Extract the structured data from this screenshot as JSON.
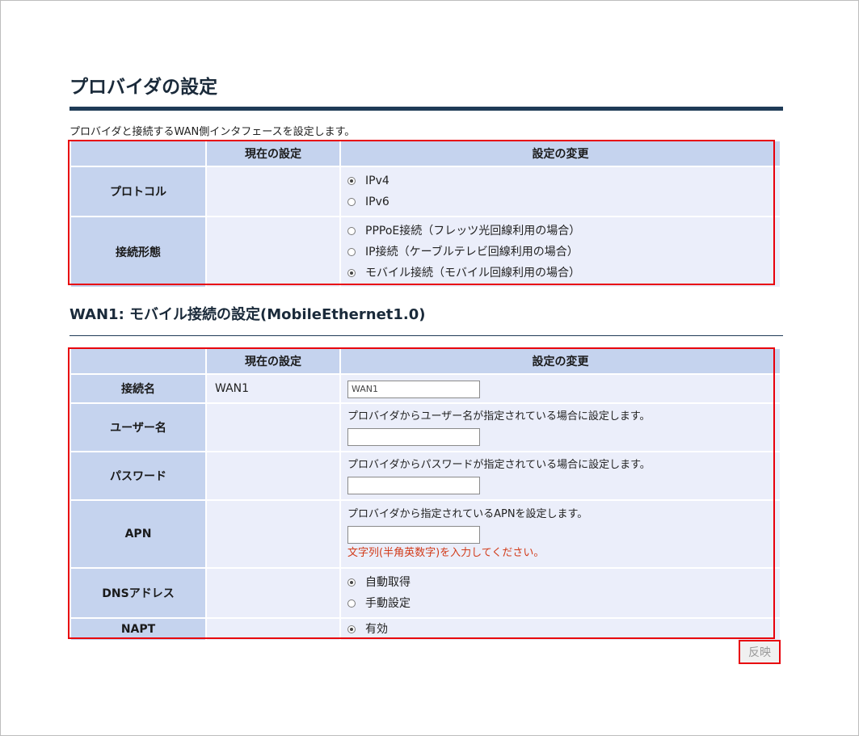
{
  "header": {
    "title": "プロバイダの設定",
    "description": "プロバイダと接続するWAN側インタフェースを設定します。"
  },
  "table_headers": {
    "current": "現在の設定",
    "change": "設定の変更"
  },
  "section1": {
    "rows": {
      "protocol": {
        "label": "プロトコル",
        "current": "",
        "options": [
          "IPv4",
          "IPv6"
        ],
        "selected": "IPv4"
      },
      "connection_type": {
        "label": "接続形態",
        "current": "",
        "options": [
          "PPPoE接続（フレッツ光回線利用の場合）",
          "IP接続（ケーブルテレビ回線利用の場合）",
          "モバイル接続（モバイル回線利用の場合）"
        ],
        "selected": "モバイル接続（モバイル回線利用の場合）"
      }
    }
  },
  "section2": {
    "title": "WAN1: モバイル接続の設定(MobileEthernet1.0)",
    "rows": {
      "connection_name": {
        "label": "接続名",
        "current": "WAN1",
        "input_value": "WAN1"
      },
      "username": {
        "label": "ユーザー名",
        "current": "",
        "hint": "プロバイダからユーザー名が指定されている場合に設定します。",
        "input_value": ""
      },
      "password": {
        "label": "パスワード",
        "current": "",
        "hint": "プロバイダからパスワードが指定されている場合に設定します。",
        "input_value": ""
      },
      "apn": {
        "label": "APN",
        "current": "",
        "hint": "プロバイダから指定されているAPNを設定します。",
        "input_value": "",
        "warning": "文字列(半角英数字)を入力してください。"
      },
      "dns": {
        "label": "DNSアドレス",
        "current": "",
        "options": [
          "自動取得",
          "手動設定"
        ],
        "selected": "自動取得"
      },
      "napt": {
        "label": "NAPT",
        "current": "",
        "options": [
          "有効"
        ],
        "selected": "有効"
      }
    }
  },
  "apply_button": {
    "label": "反映"
  },
  "colors": {
    "header_bg": "#c5d3ee",
    "cell_bg": "#ebeefa",
    "highlight": "#e8000b",
    "title_rule": "#1f3b57",
    "warning_text": "#d23a18"
  }
}
